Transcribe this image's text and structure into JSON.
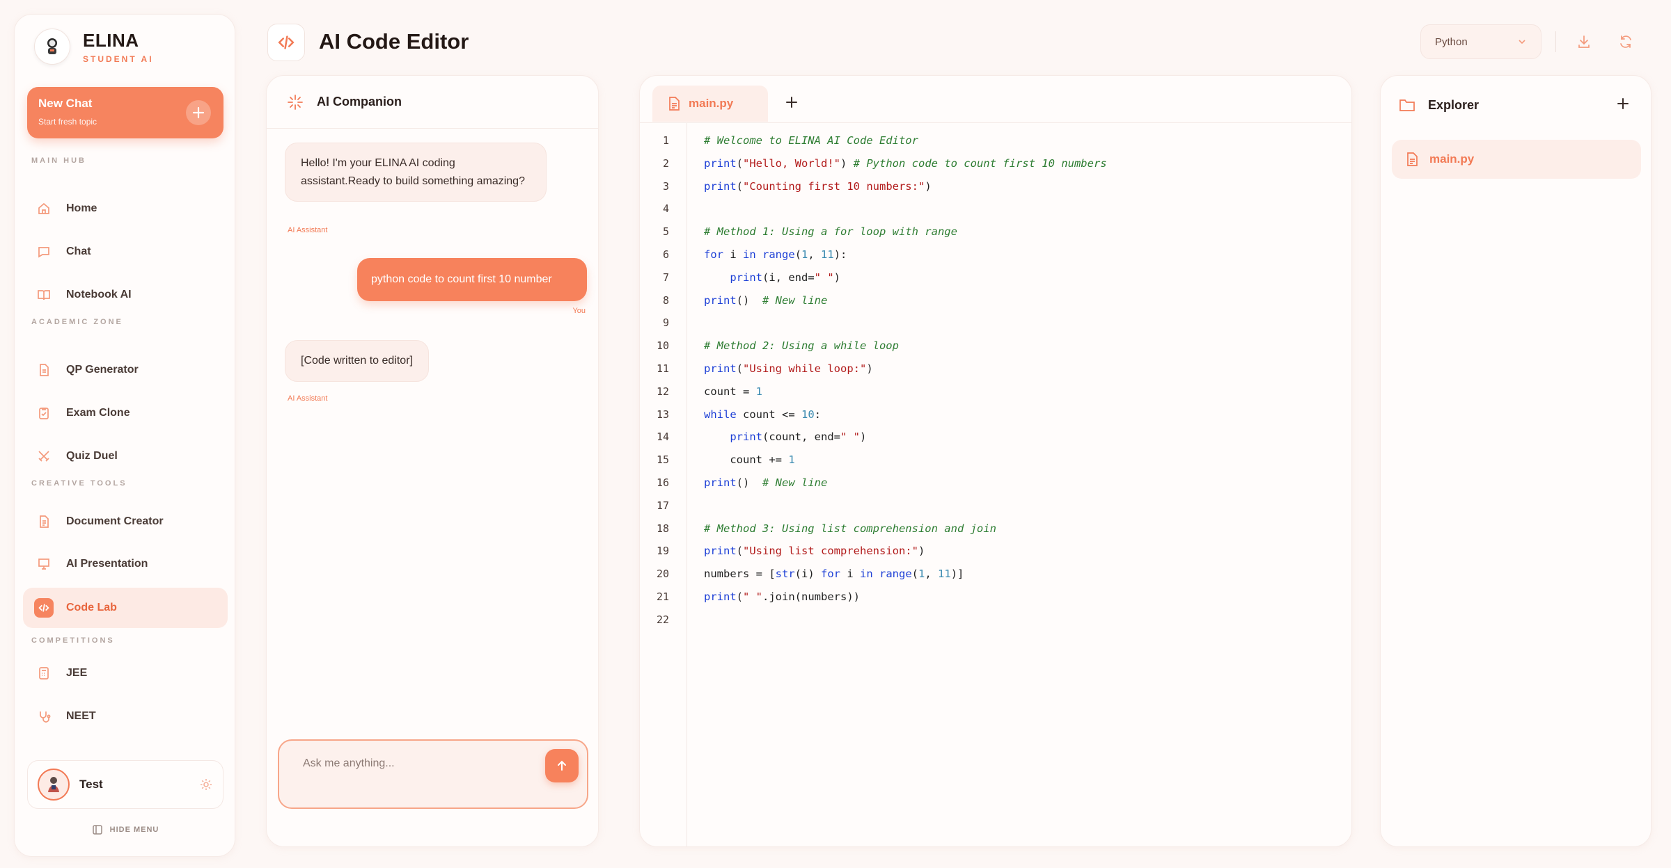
{
  "brand": {
    "name": "ELINA",
    "subtitle": "STUDENT AI"
  },
  "new_chat": {
    "title": "New Chat",
    "subtitle": "Start fresh topic"
  },
  "sidebar": {
    "sections": [
      "MAIN HUB",
      "ACADEMIC ZONE",
      "CREATIVE TOOLS",
      "COMPETITIONS"
    ],
    "items": [
      {
        "label": "Home",
        "icon": "home-icon"
      },
      {
        "label": "Chat",
        "icon": "chat-icon"
      },
      {
        "label": "Notebook AI",
        "icon": "book-icon"
      },
      {
        "label": "QP Generator",
        "icon": "document-icon"
      },
      {
        "label": "Exam Clone",
        "icon": "clipboard-icon"
      },
      {
        "label": "Quiz Duel",
        "icon": "swords-icon"
      },
      {
        "label": "Document Creator",
        "icon": "file-text-icon"
      },
      {
        "label": "AI Presentation",
        "icon": "presentation-icon"
      },
      {
        "label": "Code Lab",
        "icon": "code-icon",
        "active": true
      },
      {
        "label": "JEE",
        "icon": "calculator-icon"
      },
      {
        "label": "NEET",
        "icon": "stethoscope-icon"
      }
    ],
    "active_item": "Code Lab"
  },
  "user": {
    "name": "Test"
  },
  "hide_menu": "HIDE MENU",
  "header": {
    "title": "AI Code Editor",
    "language": "Python"
  },
  "chat": {
    "title": "AI Companion",
    "messages": [
      {
        "role": "ai",
        "text": "Hello! I'm your ELINA AI coding assistant.Ready to build something amazing?",
        "meta": "AI Assistant"
      },
      {
        "role": "user",
        "text": "python code to count first 10 number",
        "meta": "You"
      },
      {
        "role": "ai",
        "text": "[Code written to editor]",
        "meta": "AI Assistant"
      }
    ],
    "input_placeholder": "Ask me anything..."
  },
  "editor": {
    "tab": "main.py",
    "lines": [
      "# Welcome to ELINA AI Code Editor",
      "print(\"Hello, World!\") # Python code to count first 10 numbers",
      "print(\"Counting first 10 numbers:\")",
      "",
      "# Method 1: Using a for loop with range",
      "for i in range(1, 11):",
      "    print(i, end=\" \")",
      "print()  # New line",
      "",
      "# Method 2: Using a while loop",
      "print(\"Using while loop:\")",
      "count = 1",
      "while count <= 10:",
      "    print(count, end=\" \")",
      "    count += 1",
      "print()  # New line",
      "",
      "# Method 3: Using list comprehension and join",
      "print(\"Using list comprehension:\")",
      "numbers = [str(i) for i in range(1, 11)]",
      "print(\" \".join(numbers))",
      ""
    ]
  },
  "explorer": {
    "title": "Explorer",
    "files": [
      "main.py"
    ]
  },
  "colors": {
    "accent": "#f27a55",
    "background": "#fdf7f5",
    "keyword": "#1d3fd6",
    "string": "#b21b1b",
    "comment": "#2e7d32",
    "number": "#3a8ab0"
  }
}
